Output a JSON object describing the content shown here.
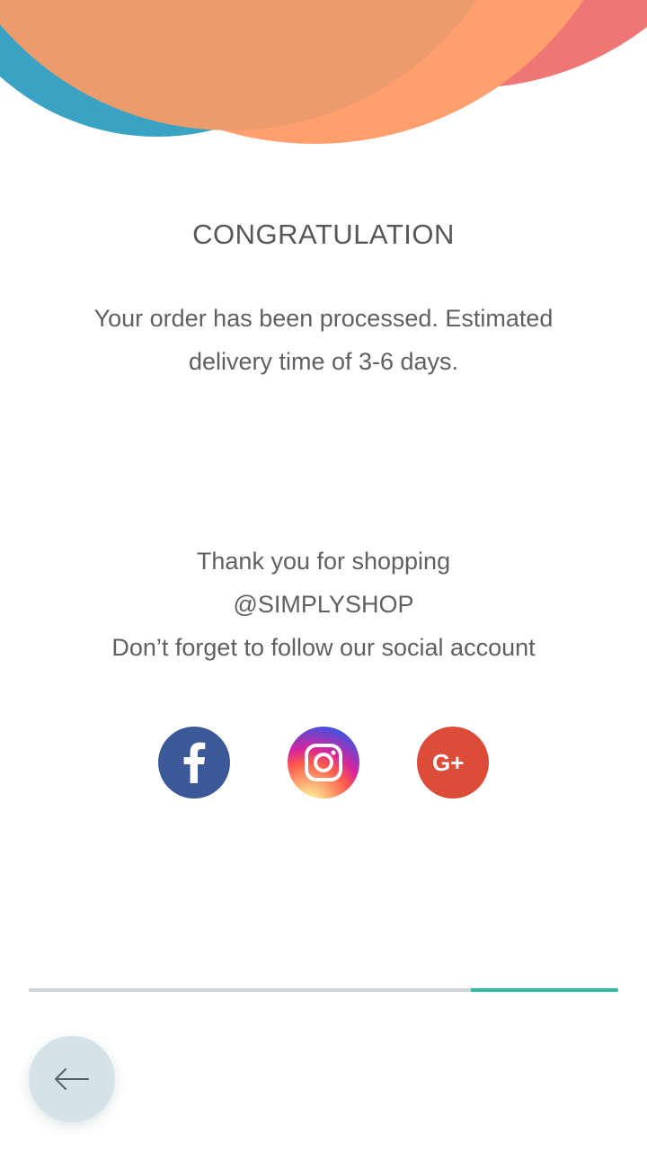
{
  "colors": {
    "header_blue": "#3aa3c4",
    "header_red": "#ee7674",
    "header_orange": "#ff9f6e",
    "header_peach": "#ec9b6d",
    "facebook": "#3b5998",
    "google_plus": "#dd4b39",
    "progress_track": "#cfd4d6",
    "progress_fill": "#2fb8a8",
    "back_button_bg": "#d5e3e8"
  },
  "page": {
    "title": "CONGRATULATION",
    "message": "Your order has been processed. Estimated delivery time of 3-6 days."
  },
  "thanks": {
    "line1": "Thank you for shopping",
    "line2": "@SIMPLYSHOP",
    "line3": "Don’t forget to follow our social account"
  },
  "social": {
    "facebook_icon": "facebook-icon",
    "instagram_icon": "instagram-icon",
    "google_plus_icon": "google-plus-icon",
    "google_plus_text": "G+"
  },
  "progress": {
    "fraction": 0.25
  },
  "back_button": {
    "icon": "arrow-left-icon"
  }
}
